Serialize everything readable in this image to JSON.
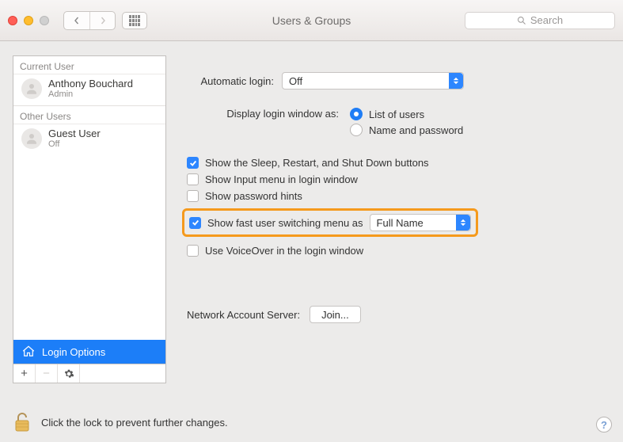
{
  "window": {
    "title": "Users & Groups",
    "searchPlaceholder": "Search"
  },
  "sidebar": {
    "sections": {
      "current": {
        "header": "Current User",
        "user": {
          "name": "Anthony Bouchard",
          "role": "Admin"
        }
      },
      "other": {
        "header": "Other Users",
        "user": {
          "name": "Guest User",
          "role": "Off"
        }
      }
    },
    "loginOptions": "Login Options"
  },
  "main": {
    "autoLoginLabel": "Automatic login:",
    "autoLoginValue": "Off",
    "displayLabel": "Display login window as:",
    "radios": {
      "list": "List of users",
      "namepw": "Name and password",
      "selected": "list"
    },
    "checks": {
      "sleep": {
        "label": "Show the Sleep, Restart, and Shut Down buttons",
        "on": true
      },
      "input": {
        "label": "Show Input menu in login window",
        "on": false
      },
      "hints": {
        "label": "Show password hints",
        "on": false
      },
      "fastswitch": {
        "label": "Show fast user switching menu as",
        "on": true,
        "value": "Full Name"
      },
      "voiceover": {
        "label": "Use VoiceOver in the login window",
        "on": false
      }
    },
    "networkLabel": "Network Account Server:",
    "joinLabel": "Join..."
  },
  "footer": {
    "lockText": "Click the lock to prevent further changes."
  }
}
